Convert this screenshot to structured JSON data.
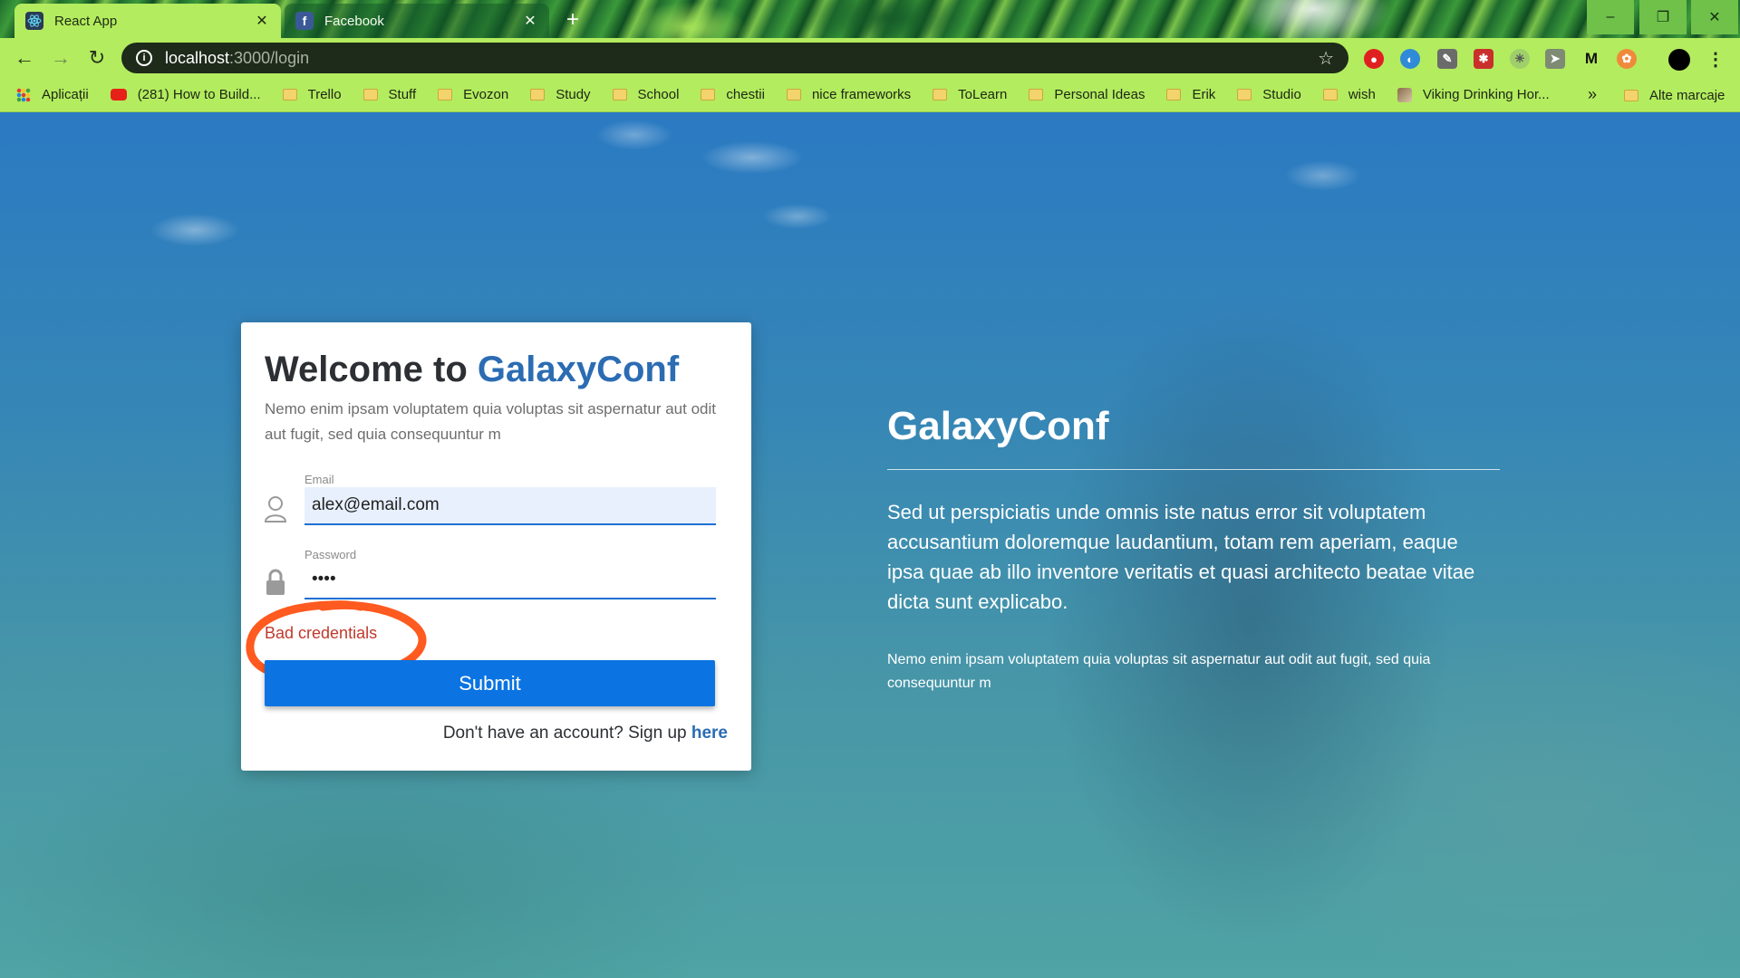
{
  "browser": {
    "tabs": [
      {
        "title": "React App",
        "close": "✕"
      },
      {
        "title": "Facebook",
        "close": "✕"
      }
    ],
    "new_tab": "+",
    "window_controls": {
      "minimize": "–",
      "restore": "❐",
      "close": "✕"
    },
    "address": {
      "host": "localhost",
      "path": ":3000/login"
    },
    "bookmarks": [
      "Aplicații",
      "(281) How to Build...",
      "Trello",
      "Stuff",
      "Evozon",
      "Study",
      "School",
      "chestii",
      "nice frameworks",
      "ToLearn",
      "Personal Ideas",
      "Erik",
      "Studio",
      "wish",
      "Viking Drinking Hor..."
    ],
    "bookmarks_more": "»",
    "other_bookmarks": "Alte marcaje",
    "extension_m": "M"
  },
  "login": {
    "title_prefix": "Welcome to ",
    "title_brand": "GalaxyConf",
    "subtitle": "Nemo enim ipsam voluptatem quia voluptas sit aspernatur aut odit aut fugit, sed quia consequuntur m",
    "email_label": "Email",
    "email_value": "alex@email.com",
    "password_label": "Password",
    "password_value": "••••",
    "error": "Bad credentials",
    "submit": "Submit",
    "signup_text": "Don't have an account? Sign up ",
    "signup_link": "here"
  },
  "hero": {
    "title": "GalaxyConf",
    "lead": "Sed ut perspiciatis unde omnis iste natus error sit voluptatem accusantium doloremque laudantium, totam rem aperiam, eaque ipsa quae ab illo inventore veritatis et quasi architecto beatae vitae dicta sunt explicabo.",
    "small": "Nemo enim ipsam voluptatem quia voluptas sit aspernatur aut odit aut fugit, sed quia consequuntur m"
  },
  "colors": {
    "brand": "#2b6cb3",
    "submit": "#0b74e2",
    "error": "#c0392b",
    "annotation": "#ff5a1f",
    "chrome_frame": "#b3ec5e"
  }
}
